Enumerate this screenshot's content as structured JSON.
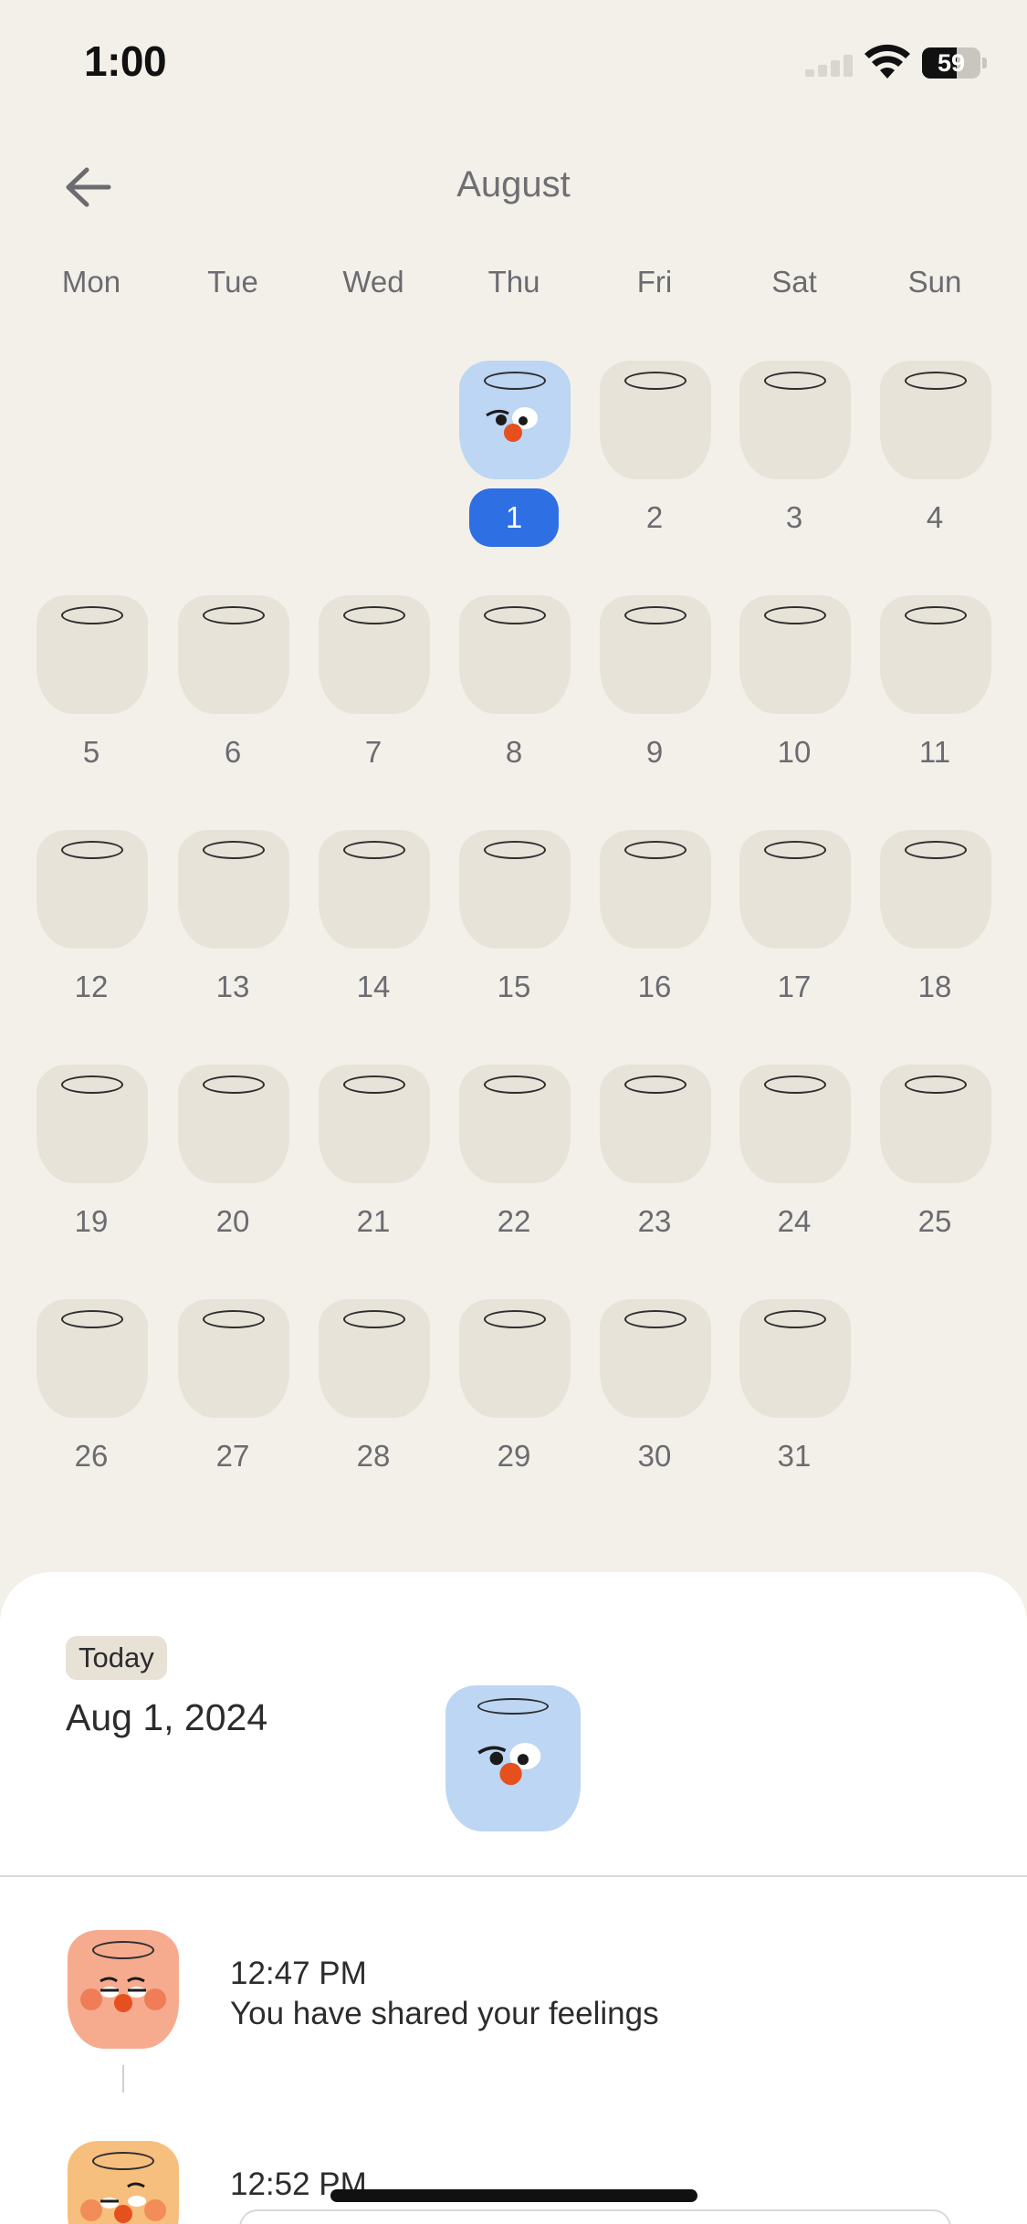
{
  "status_bar": {
    "time": "1:00",
    "battery": "59",
    "battery_level": 59
  },
  "header": {
    "title": "August",
    "back_icon": "arrow-left-icon"
  },
  "weekdays": [
    "Mon",
    "Tue",
    "Wed",
    "Thu",
    "Fri",
    "Sat",
    "Sun"
  ],
  "calendar": {
    "first_weekday_index": 3,
    "days_in_month": 31,
    "selected_day": 1,
    "logged_days": [
      1
    ],
    "day_labels": [
      "1",
      "2",
      "3",
      "4",
      "5",
      "6",
      "7",
      "8",
      "9",
      "10",
      "11",
      "12",
      "13",
      "14",
      "15",
      "16",
      "17",
      "18",
      "19",
      "20",
      "21",
      "22",
      "23",
      "24",
      "25",
      "26",
      "27",
      "28",
      "29",
      "30",
      "31"
    ]
  },
  "colors": {
    "accent": "#2e6fe4",
    "jar_empty": "#e8e3d8",
    "jar_blue": "#bcd6f3",
    "jar_coral": "#f6ab8f",
    "jar_orange": "#f7bf7d",
    "background": "#f3f0ea"
  },
  "sheet": {
    "badge": "Today",
    "date": "Aug 1, 2024",
    "jar_icon": "blue-mood-jar-icon",
    "entries": [
      {
        "time": "12:47 PM",
        "text": "You have shared your feelings",
        "icon": "coral-mood-jar-icon"
      },
      {
        "time": "12:52 PM",
        "text": "",
        "icon": "orange-mood-jar-icon"
      }
    ]
  }
}
